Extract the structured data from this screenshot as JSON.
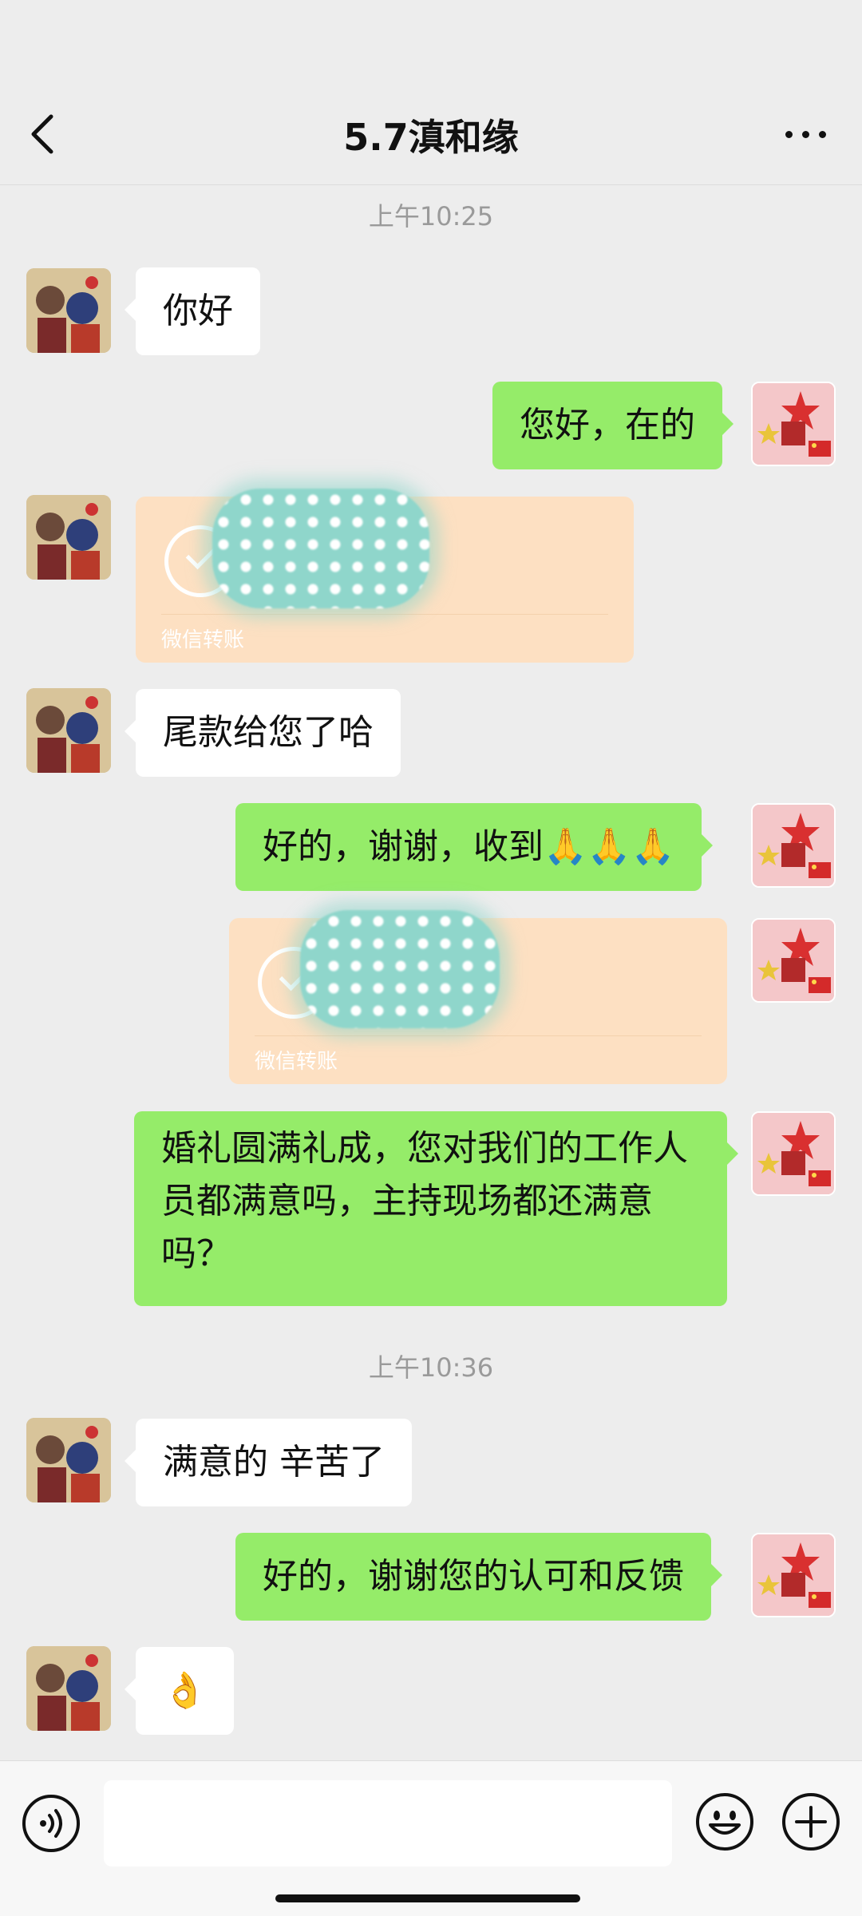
{
  "header": {
    "title": "5.7滇和缘"
  },
  "messages": {
    "time1": "上午10:25",
    "m1": "你好",
    "m2": "您好，在的",
    "transfer1_label": "微信转账",
    "m4": "尾款给您了哈",
    "m5": "好的，谢谢，收到🙏🙏🙏",
    "transfer2_label": "微信转账",
    "m7": "婚礼圆满礼成，您对我们的工作人员都满意吗，主持现场都还满意吗？",
    "time2": "上午10:36",
    "m8": "满意的 辛苦了",
    "m9": "好的，谢谢您的认可和反馈",
    "m10": "👌"
  },
  "icons": {
    "back": "chevron-left-icon",
    "more": "more-dots-icon",
    "voice": "voice-icon",
    "emoji": "emoji-icon",
    "plus": "plus-icon"
  },
  "colors": {
    "background": "#ededed",
    "bubble_green": "#95ec69",
    "bubble_white": "#ffffff",
    "transfer": "#fde0c2"
  }
}
